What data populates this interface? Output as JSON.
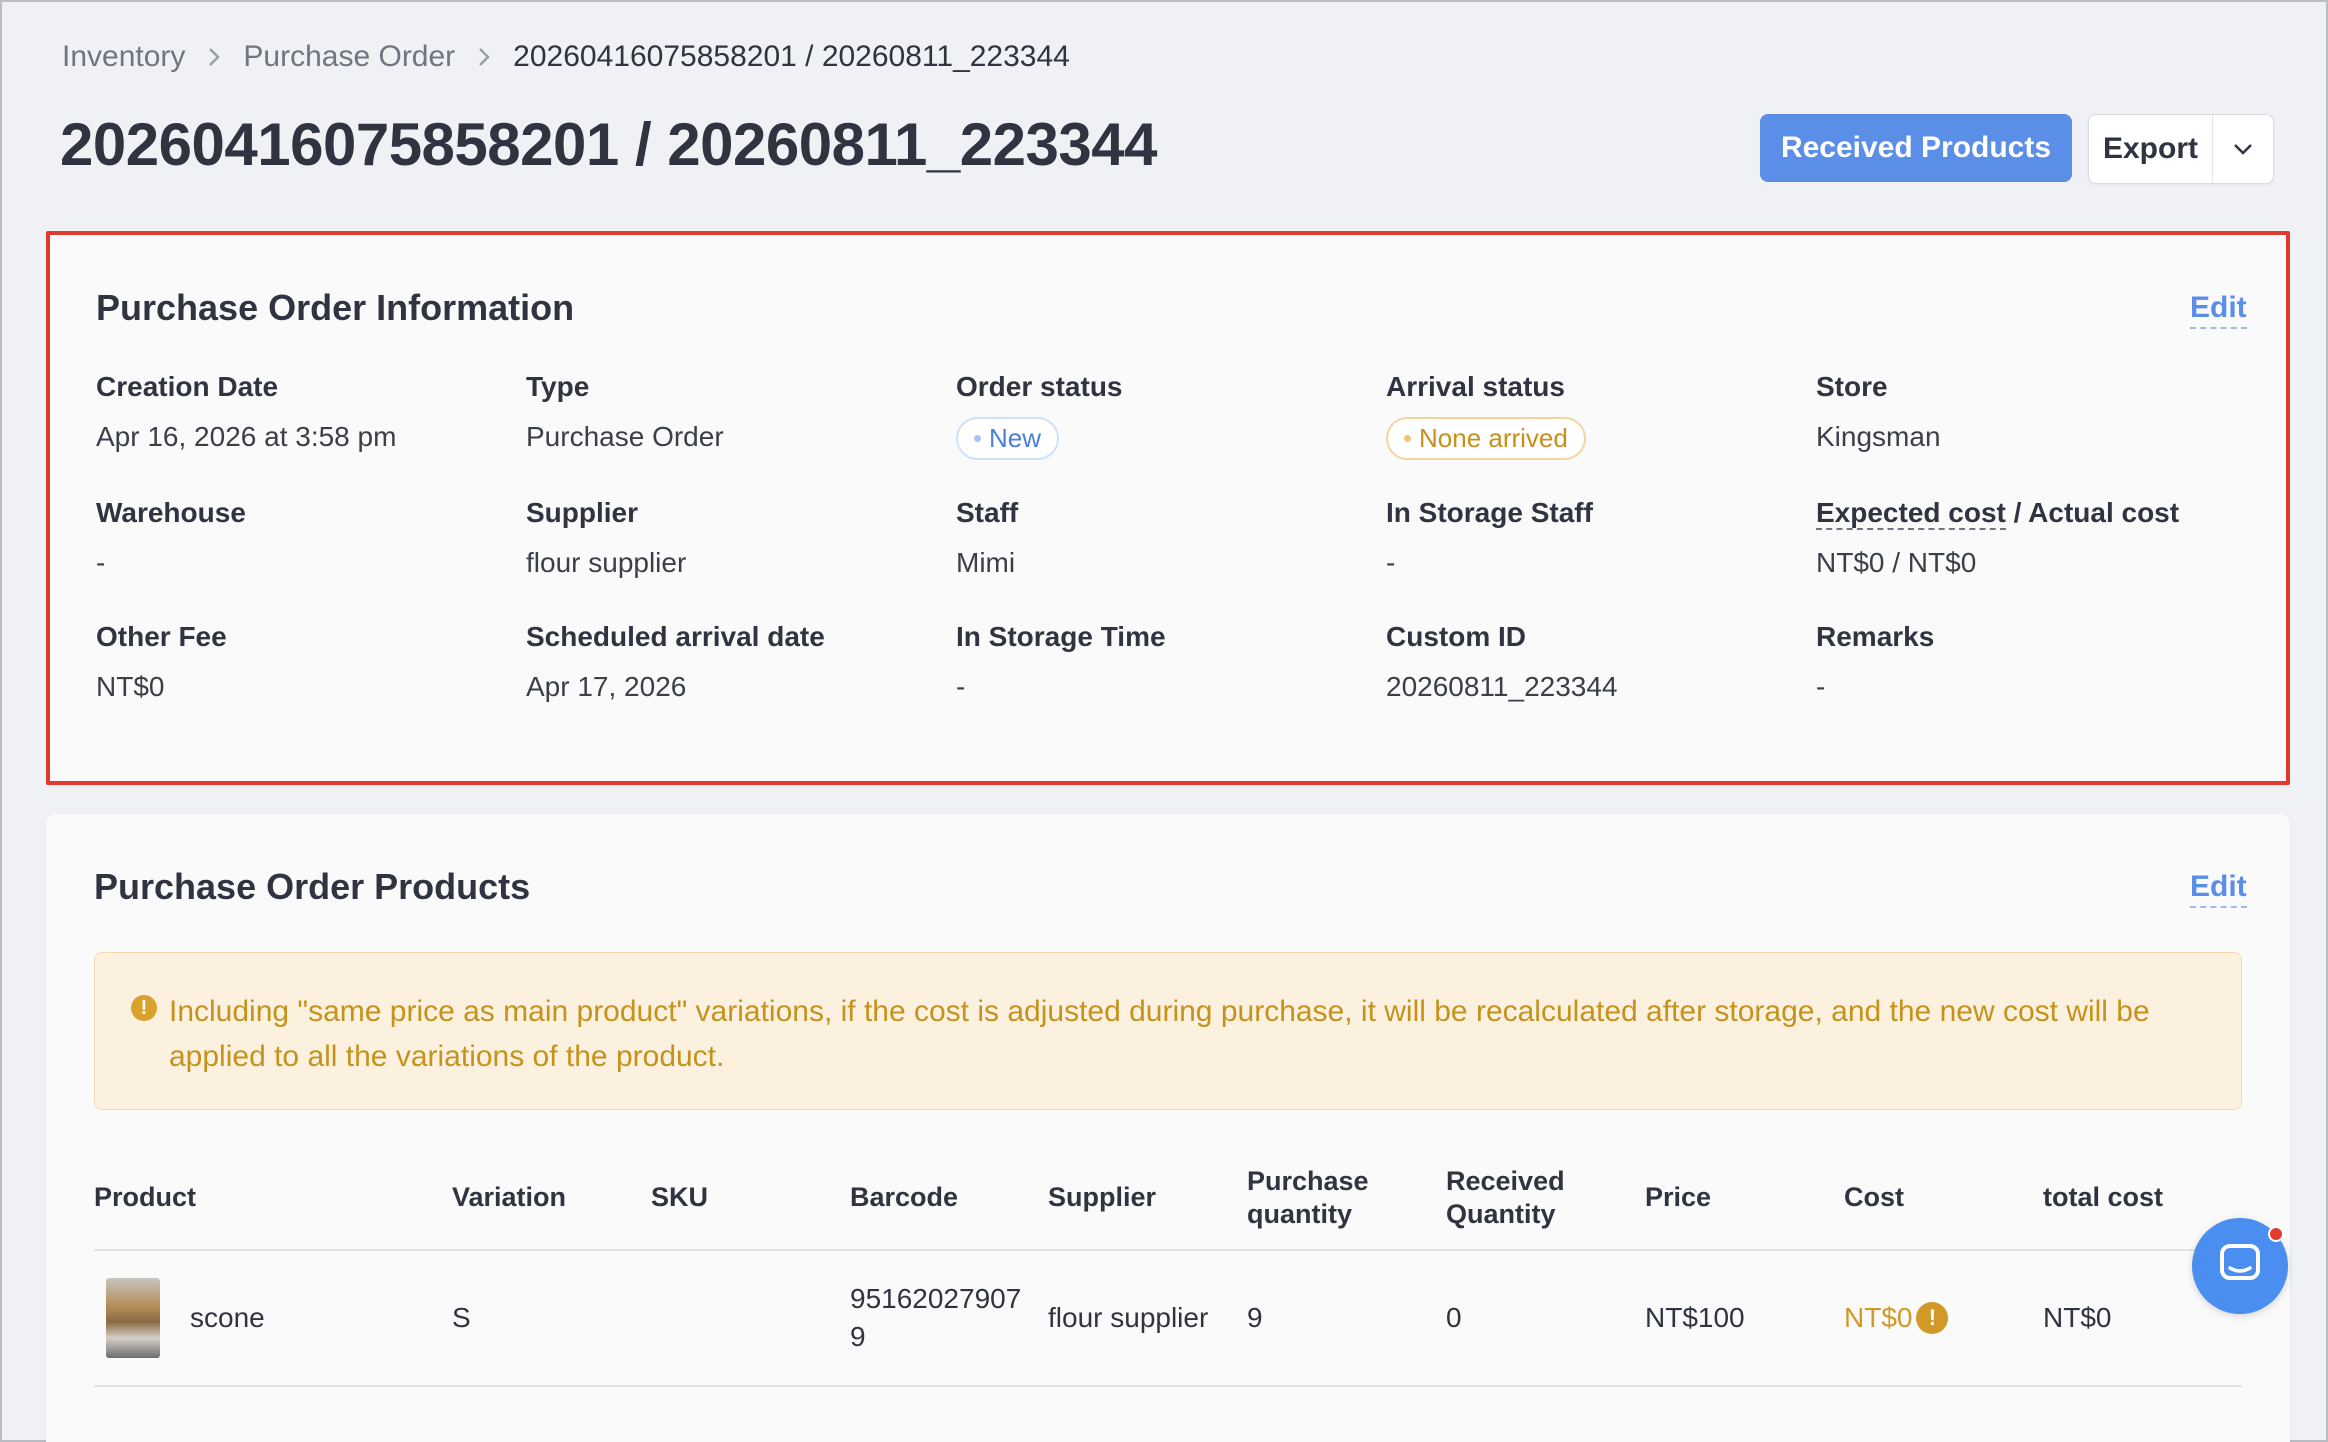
{
  "breadcrumb": {
    "items": [
      "Inventory",
      "Purchase Order"
    ],
    "current": "20260416075858201 / 20260811_223344"
  },
  "page": {
    "title": "20260416075858201 / 20260811_223344",
    "received_button": "Received Products",
    "export_button": "Export"
  },
  "info": {
    "title": "Purchase Order Information",
    "edit": "Edit",
    "creation_date": {
      "label": "Creation Date",
      "value": "Apr 16, 2026 at 3:58 pm"
    },
    "type": {
      "label": "Type",
      "value": "Purchase Order"
    },
    "order_status": {
      "label": "Order status",
      "value": "New"
    },
    "arrival_status": {
      "label": "Arrival status",
      "value": "None arrived"
    },
    "store": {
      "label": "Store",
      "value": "Kingsman"
    },
    "warehouse": {
      "label": "Warehouse",
      "value": "-"
    },
    "supplier": {
      "label": "Supplier",
      "value": "flour supplier"
    },
    "staff": {
      "label": "Staff",
      "value": "Mimi"
    },
    "in_storage_staff": {
      "label": "In Storage Staff",
      "value": "-"
    },
    "cost": {
      "label_expected": "Expected cost",
      "label_rest": " / Actual cost",
      "value": "NT$0 / NT$0"
    },
    "other_fee": {
      "label": "Other Fee",
      "value": "NT$0"
    },
    "scheduled_arrival": {
      "label": "Scheduled arrival date",
      "value": "Apr 17, 2026"
    },
    "in_storage_time": {
      "label": "In Storage Time",
      "value": "-"
    },
    "custom_id": {
      "label": "Custom ID",
      "value": "20260811_223344"
    },
    "remarks": {
      "label": "Remarks",
      "value": "-"
    }
  },
  "products": {
    "title": "Purchase Order Products",
    "edit": "Edit",
    "notice": "Including \"same price as main product\" variations, if the cost is adjusted during purchase, it will be recalculated after storage, and the new cost will be applied to all the variations of the product.",
    "columns": {
      "product": "Product",
      "variation": "Variation",
      "sku": "SKU",
      "barcode": "Barcode",
      "supplier": "Supplier",
      "purchase_qty_1": "Purchase",
      "purchase_qty_2": "quantity",
      "received_qty_1": "Received",
      "received_qty_2": "Quantity",
      "price": "Price",
      "cost": "Cost",
      "total_cost": "total cost"
    },
    "rows": [
      {
        "product": "scone",
        "variation": "S",
        "sku": "",
        "barcode_1": "95162027907",
        "barcode_2": "9",
        "supplier": "flour supplier",
        "purchase_qty": "9",
        "received_qty": "0",
        "price": "NT$100",
        "cost": "NT$0",
        "total_cost": "NT$0"
      }
    ]
  },
  "colors": {
    "primary": "#5b8ee6",
    "highlight_border": "#e0392d",
    "warning": "#c5931d",
    "background": "#f0f1f4"
  }
}
